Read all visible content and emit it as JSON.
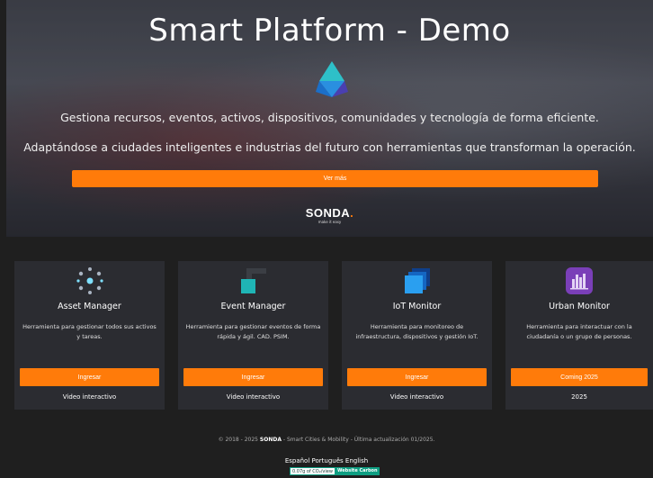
{
  "hero": {
    "title": "Smart Platform - Demo",
    "line1": "Gestiona recursos, eventos, activos, dispositivos, comunidades y tecnología de forma eficiente.",
    "line2": "Adaptándose a ciudades inteligentes e industrias del futuro con herramientas que transforman la operación.",
    "cta_label": "Ver más",
    "brand": "SONDA",
    "brand_dot": ".",
    "brand_tagline": "make it easy",
    "accent_color": "#ff7b0a"
  },
  "cards": [
    {
      "name": "Asset Manager",
      "description": "Herramienta para gestionar todos sus activos y tareas.",
      "button": "Ingresar",
      "link": "Video interactivo",
      "icon": "network-nodes-icon"
    },
    {
      "name": "Event Manager",
      "description": "Herramienta para gestionar eventos de forma rápida y ágil. CAD. PSIM.",
      "button": "Ingresar",
      "link": "Video interactivo",
      "icon": "event-frame-icon"
    },
    {
      "name": "IoT Monitor",
      "description": "Herramienta para monitoreo de infraestructura, dispositivos y gestión IoT.",
      "button": "Ingresar",
      "link": "Video interactivo",
      "icon": "stacked-squares-icon"
    },
    {
      "name": "Urban Monitor",
      "description": "Herramienta para interactuar con la ciudadanía o un grupo de personas.",
      "button": "Coming 2025",
      "link": "2025",
      "icon": "city-skyline-icon"
    }
  ],
  "footer": {
    "copy_prefix": "© 2018 - 2025",
    "brand": "SONDA",
    "copy_suffix": "- Smart Cities & Mobility - Última actualización 01/2025.",
    "languages": [
      "Español",
      "Português",
      "English"
    ],
    "carbon_value": "0.07g of CO₂/view",
    "carbon_label": "Website Carbon"
  }
}
